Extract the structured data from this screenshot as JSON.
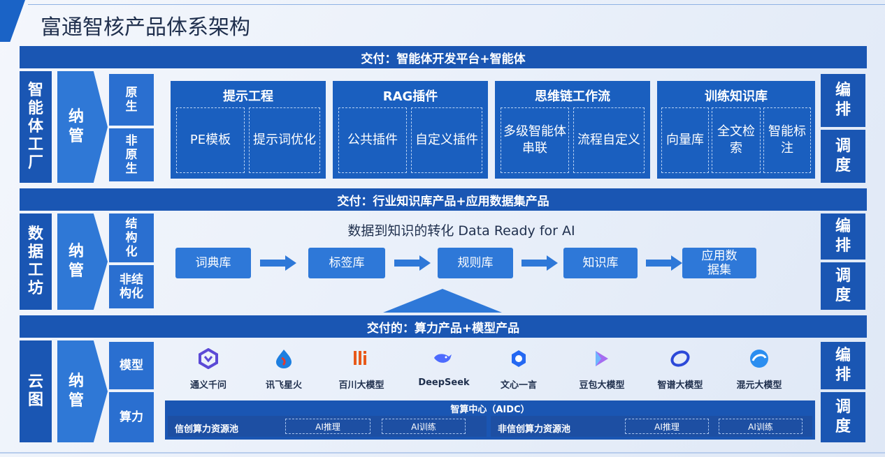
{
  "title": "富通智核产品体系架构",
  "rows": {
    "factory": {
      "band": "交付：智能体开发平台+智能体",
      "left": "智能体工厂",
      "manage": "纳管",
      "sub_top": "原生",
      "sub_bottom": "非原生",
      "right_top": "编排",
      "right_bottom": "调度",
      "panels": [
        {
          "title": "提示工程",
          "cells": [
            "PE模板",
            "提示词优化"
          ]
        },
        {
          "title": "RAG插件",
          "cells": [
            "公共插件",
            "自定义插件"
          ]
        },
        {
          "title": "思维链工作流",
          "cells": [
            "多级智能体串联",
            "流程自定义"
          ]
        },
        {
          "title": "训练知识库",
          "cells": [
            "向量库",
            "全文检索",
            "智能标注"
          ]
        }
      ]
    },
    "data": {
      "band": "交付：行业知识库产品+应用数据集产品",
      "left": "数据工坊",
      "manage": "纳管",
      "sub_top": "结构化",
      "sub_bottom": "非结构化",
      "right_top": "编排",
      "right_bottom": "调度",
      "headline": "数据到知识的转化 Data Ready for AI",
      "flow": [
        "词典库",
        "标签库",
        "规则库",
        "知识库",
        "应用数据集"
      ]
    },
    "cloud": {
      "band": "交付的：算力产品+模型产品",
      "left": "云图",
      "manage": "纳管",
      "sub_top": "模型",
      "sub_bottom": "算力",
      "right_top": "编排",
      "right_bottom": "调度",
      "models": [
        "通义千问",
        "讯飞星火",
        "百川大模型",
        "DeepSeek",
        "文心一言",
        "豆包大模型",
        "智谱大模型",
        "混元大模型"
      ],
      "aidc_title": "智算中心（AIDC）",
      "pool_left": "信创算力资源池",
      "pool_right": "非信创算力资源池",
      "tag_infer": "AI推理",
      "tag_train": "AI训练"
    }
  },
  "colors": {
    "primary": "#1a56b3",
    "accent": "#2e78d8",
    "background": "#eef3fb"
  }
}
